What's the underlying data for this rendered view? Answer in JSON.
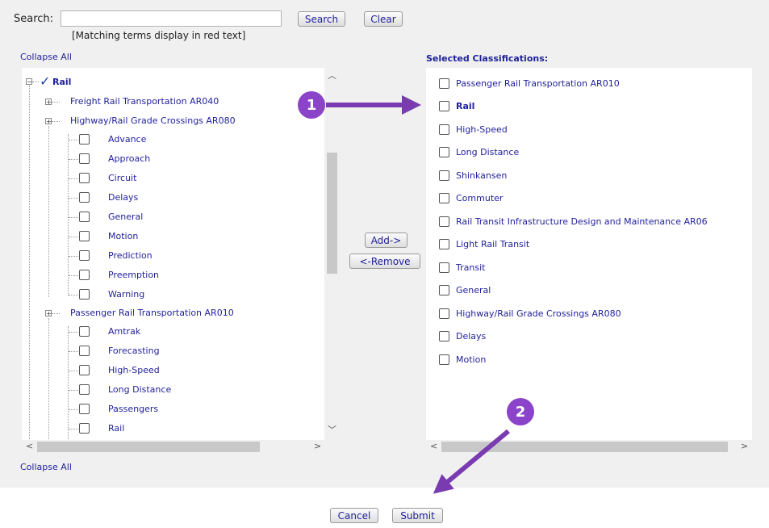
{
  "search": {
    "label": "Search:",
    "value": "",
    "placeholder": "",
    "hint": "[Matching terms display in red text]",
    "search_button": "Search",
    "clear_button": "Clear"
  },
  "links": {
    "collapse_all_top": "Collapse All",
    "collapse_all_bottom": "Collapse All"
  },
  "tree": {
    "root": {
      "label": "Rail",
      "checked": true
    },
    "nodes": [
      {
        "label": "Freight Rail Transportation AR040",
        "expandable": true
      },
      {
        "label": "Highway/Rail Grade Crossings AR080",
        "expandable": true,
        "children": [
          "Advance",
          "Approach",
          "Circuit",
          "Delays",
          "General",
          "Motion",
          "Prediction",
          "Preemption",
          "Warning"
        ]
      },
      {
        "label": "Passenger Rail Transportation AR010",
        "expandable": true,
        "children": [
          "Amtrak",
          "Forecasting",
          "High-Speed",
          "Long Distance",
          "Passengers",
          "Rail"
        ]
      }
    ]
  },
  "middle": {
    "add_button": "Add->",
    "remove_button": "<-Remove"
  },
  "selected": {
    "title": "Selected Classifications:",
    "items": [
      {
        "label": "Passenger Rail Transportation AR010",
        "bold": false
      },
      {
        "label": "Rail",
        "bold": true
      },
      {
        "label": "High-Speed",
        "bold": false
      },
      {
        "label": "Long Distance",
        "bold": false
      },
      {
        "label": "Shinkansen",
        "bold": false
      },
      {
        "label": "Commuter",
        "bold": false
      },
      {
        "label": "Rail Transit Infrastructure Design and Maintenance AR06",
        "bold": false
      },
      {
        "label": "Light Rail Transit",
        "bold": false
      },
      {
        "label": "Transit",
        "bold": false
      },
      {
        "label": "General",
        "bold": false
      },
      {
        "label": "Highway/Rail Grade Crossings AR080",
        "bold": false
      },
      {
        "label": "Delays",
        "bold": false
      },
      {
        "label": "Motion",
        "bold": false
      }
    ]
  },
  "footer": {
    "cancel_button": "Cancel",
    "submit_button": "Submit"
  },
  "annotations": {
    "badge_1": "1",
    "badge_2": "2",
    "color": "#8b44c9"
  },
  "colors": {
    "link": "#1f1f9a",
    "panel": "#f0f0f0",
    "check": "#1f3fa8"
  },
  "icons": {
    "expand": "plus-box-icon",
    "collapse": "minus-box-icon",
    "checkmark": "checkmark-icon",
    "scroll_up": "chevron-up-icon",
    "scroll_down": "chevron-down-icon",
    "scroll_left": "chevron-left-icon",
    "scroll_right": "chevron-right-icon"
  }
}
